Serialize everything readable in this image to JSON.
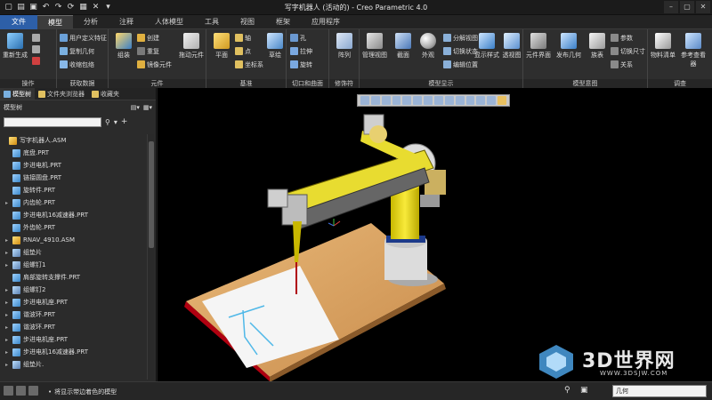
{
  "window": {
    "title": "写字机器人 (活动的) - Creo Parametric 4.0"
  },
  "tabs": [
    "文件",
    "模型",
    "分析",
    "注释",
    "人体模型",
    "工具",
    "视图",
    "框架",
    "应用程序"
  ],
  "ribbon": {
    "groups": [
      "操作",
      "获取数据",
      "元件",
      "基准",
      "切口和曲面",
      "修饰符",
      "模型显示",
      "模型意图",
      "调查"
    ],
    "operations": {
      "regenerate": "重新生成"
    },
    "get_data": {
      "udf": "用户定义特征",
      "copy_geom": "复制几何",
      "shrinkwrap": "收缩包络"
    },
    "component": {
      "assemble": "组装",
      "create": "创建",
      "repeat": "重复",
      "mirror": "镜像元件",
      "drag": "拖动元件"
    },
    "datum": {
      "plane": "平面",
      "axis": "轴",
      "point": "点",
      "csys": "坐标系",
      "sketch": "草绘"
    },
    "cuts": {
      "hole": "孔",
      "extrude": "拉伸",
      "revolve": "旋转"
    },
    "modifiers": {
      "pattern": "阵列"
    },
    "display": {
      "manage_views": "管理视图",
      "section": "截面",
      "appearance": "外观",
      "explode": "分解视图",
      "toggle_state": "切换状态",
      "edit_pos": "编辑位置",
      "display_style": "显示样式",
      "perspective": "透视图"
    },
    "intent": {
      "component_interface": "元件界面",
      "publish_geom": "发布几何",
      "family_table": "族表",
      "params": "参数",
      "switch_dims": "切换尺寸",
      "relations": "关系"
    },
    "investigate": {
      "bom": "物料清单",
      "ref_viewer": "参考查看器"
    }
  },
  "panel": {
    "tabs": [
      "模型树",
      "文件夹浏览器",
      "收藏夹"
    ],
    "header": "模型树",
    "tree": [
      {
        "label": "写字机器人.ASM",
        "icon": "asm",
        "exp": ""
      },
      {
        "label": "底盘.PRT",
        "icon": "prt",
        "exp": ""
      },
      {
        "label": "步进电机.PRT",
        "icon": "prt",
        "exp": ""
      },
      {
        "label": "链接圆盘.PRT",
        "icon": "prt",
        "exp": ""
      },
      {
        "label": "旋转件.PRT",
        "icon": "prt",
        "exp": ""
      },
      {
        "label": "内齿轮.PRT",
        "icon": "prt",
        "exp": "▸"
      },
      {
        "label": "步进电机16减速器.PRT",
        "icon": "prt",
        "exp": ""
      },
      {
        "label": "外齿轮.PRT",
        "icon": "prt",
        "exp": ""
      },
      {
        "label": "RNAV_4910.ASM",
        "icon": "asm",
        "exp": "▸"
      },
      {
        "label": "组垫片",
        "icon": "grp",
        "exp": "▸"
      },
      {
        "label": "组螺钉1",
        "icon": "grp",
        "exp": "▸"
      },
      {
        "label": "肩部旋转支撑件.PRT",
        "icon": "prt",
        "exp": ""
      },
      {
        "label": "组螺钉2",
        "icon": "grp",
        "exp": "▸"
      },
      {
        "label": "步进电机座.PRT",
        "icon": "prt",
        "exp": "▸"
      },
      {
        "label": "谐波环.PRT",
        "icon": "prt",
        "exp": "▸"
      },
      {
        "label": "谐波环.PRT",
        "icon": "prt",
        "exp": "▸"
      },
      {
        "label": "步进电机座.PRT",
        "icon": "prt",
        "exp": "▸"
      },
      {
        "label": "步进电机16减速器.PRT",
        "icon": "prt",
        "exp": "▸"
      },
      {
        "label": "组垫片.",
        "icon": "grp",
        "exp": "▸"
      }
    ]
  },
  "status": {
    "message": "将显示带边着色的模型",
    "filter": "几何"
  },
  "watermark": {
    "main": "3D世界网",
    "sub": "WWW.3DSJW.COM"
  }
}
